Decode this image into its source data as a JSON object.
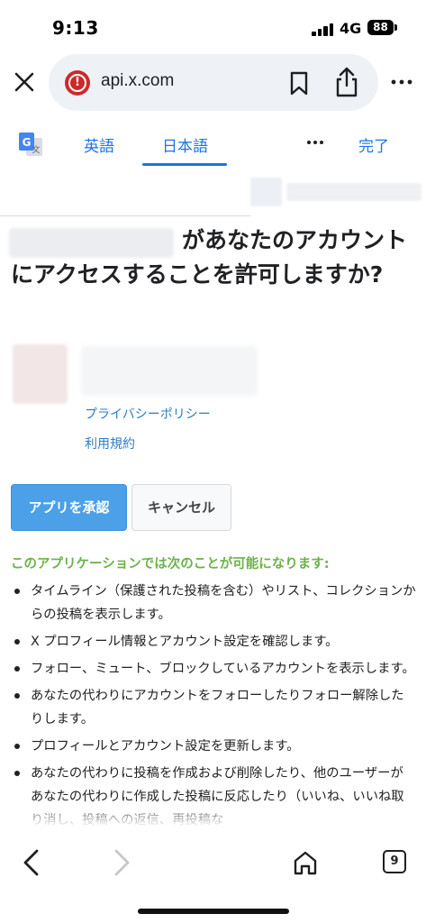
{
  "status": {
    "time": "9:13",
    "network": "4G",
    "battery": "88"
  },
  "browser": {
    "url": "api.x.com",
    "close_icon": "close-icon",
    "site_icon": "site-warning-icon",
    "bookmark_icon": "bookmark-icon",
    "share_icon": "share-icon",
    "more_icon": "more-vertical-icon"
  },
  "translate_bar": {
    "source_lang": "英語",
    "target_lang": "日本語",
    "done_label": "完了",
    "accent": "#1a73e8"
  },
  "auth": {
    "title": "があなたのアカウントにアクセスすることを許可しますか?",
    "privacy_link": "プライバシーポリシー",
    "terms_link": "利用規約",
    "approve_label": "アプリを承認",
    "cancel_label": "キャンセル",
    "approve_color": "#4ba0e8"
  },
  "permissions": {
    "heading": "このアプリケーションでは次のことが可能になります:",
    "heading_color": "#6cb24a",
    "items": [
      "タイムライン（保護された投稿を含む）やリスト、コレクションからの投稿を表示します。",
      "X プロフィール情報とアカウント設定を確認します。",
      "フォロー、ミュート、ブロックしているアカウントを表示します。",
      "あなたの代わりにアカウントをフォローしたりフォロー解除したりします。",
      "プロフィールとアカウント設定を更新します。",
      "あなたの代わりに投稿を作成および削除したり、他のユーザーがあなたの代わりに作成した投稿に反応したり（いいね、いいね取り消し、投稿への返信、再投稿な"
    ]
  },
  "toolbar": {
    "tab_count": "9"
  }
}
